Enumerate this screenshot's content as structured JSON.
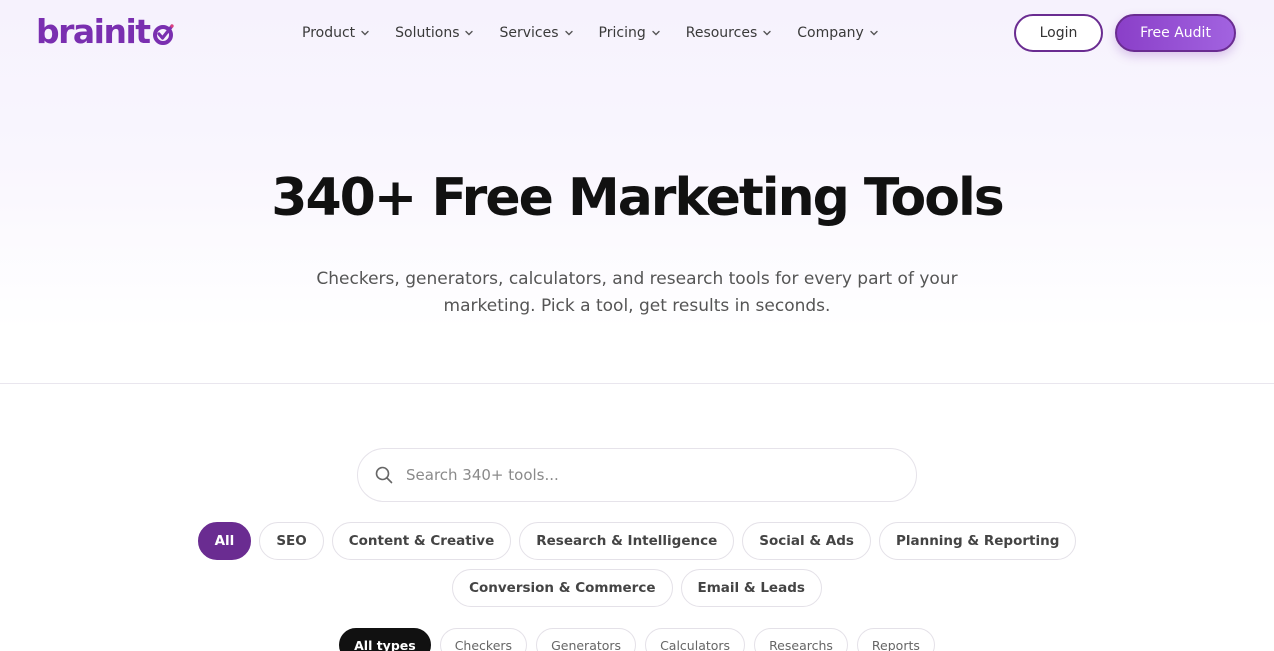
{
  "brand": {
    "name": "brainit",
    "color": "#7a2fb0"
  },
  "nav": {
    "items": [
      {
        "label": "Product"
      },
      {
        "label": "Solutions"
      },
      {
        "label": "Services"
      },
      {
        "label": "Pricing"
      },
      {
        "label": "Resources"
      },
      {
        "label": "Company"
      }
    ],
    "login_label": "Login",
    "audit_label": "Free Audit"
  },
  "hero": {
    "title": "340+ Free Marketing Tools",
    "subtitle": "Checkers, generators, calculators, and research tools for every part of your marketing. Pick a tool, get results in seconds."
  },
  "search": {
    "placeholder": "Search 340+ tools..."
  },
  "categories": [
    {
      "label": "All",
      "active": true
    },
    {
      "label": "SEO"
    },
    {
      "label": "Content & Creative"
    },
    {
      "label": "Research & Intelligence"
    },
    {
      "label": "Social & Ads"
    },
    {
      "label": "Planning & Reporting"
    },
    {
      "label": "Conversion & Commerce"
    },
    {
      "label": "Email & Leads"
    }
  ],
  "types": [
    {
      "label": "All types",
      "active": true
    },
    {
      "label": "Checkers"
    },
    {
      "label": "Generators"
    },
    {
      "label": "Calculators"
    },
    {
      "label": "Researchs"
    },
    {
      "label": "Reports"
    }
  ],
  "colors": {
    "accent": "#6a2c91",
    "accent_light": "#a263e0",
    "dark_pill": "#111111"
  }
}
